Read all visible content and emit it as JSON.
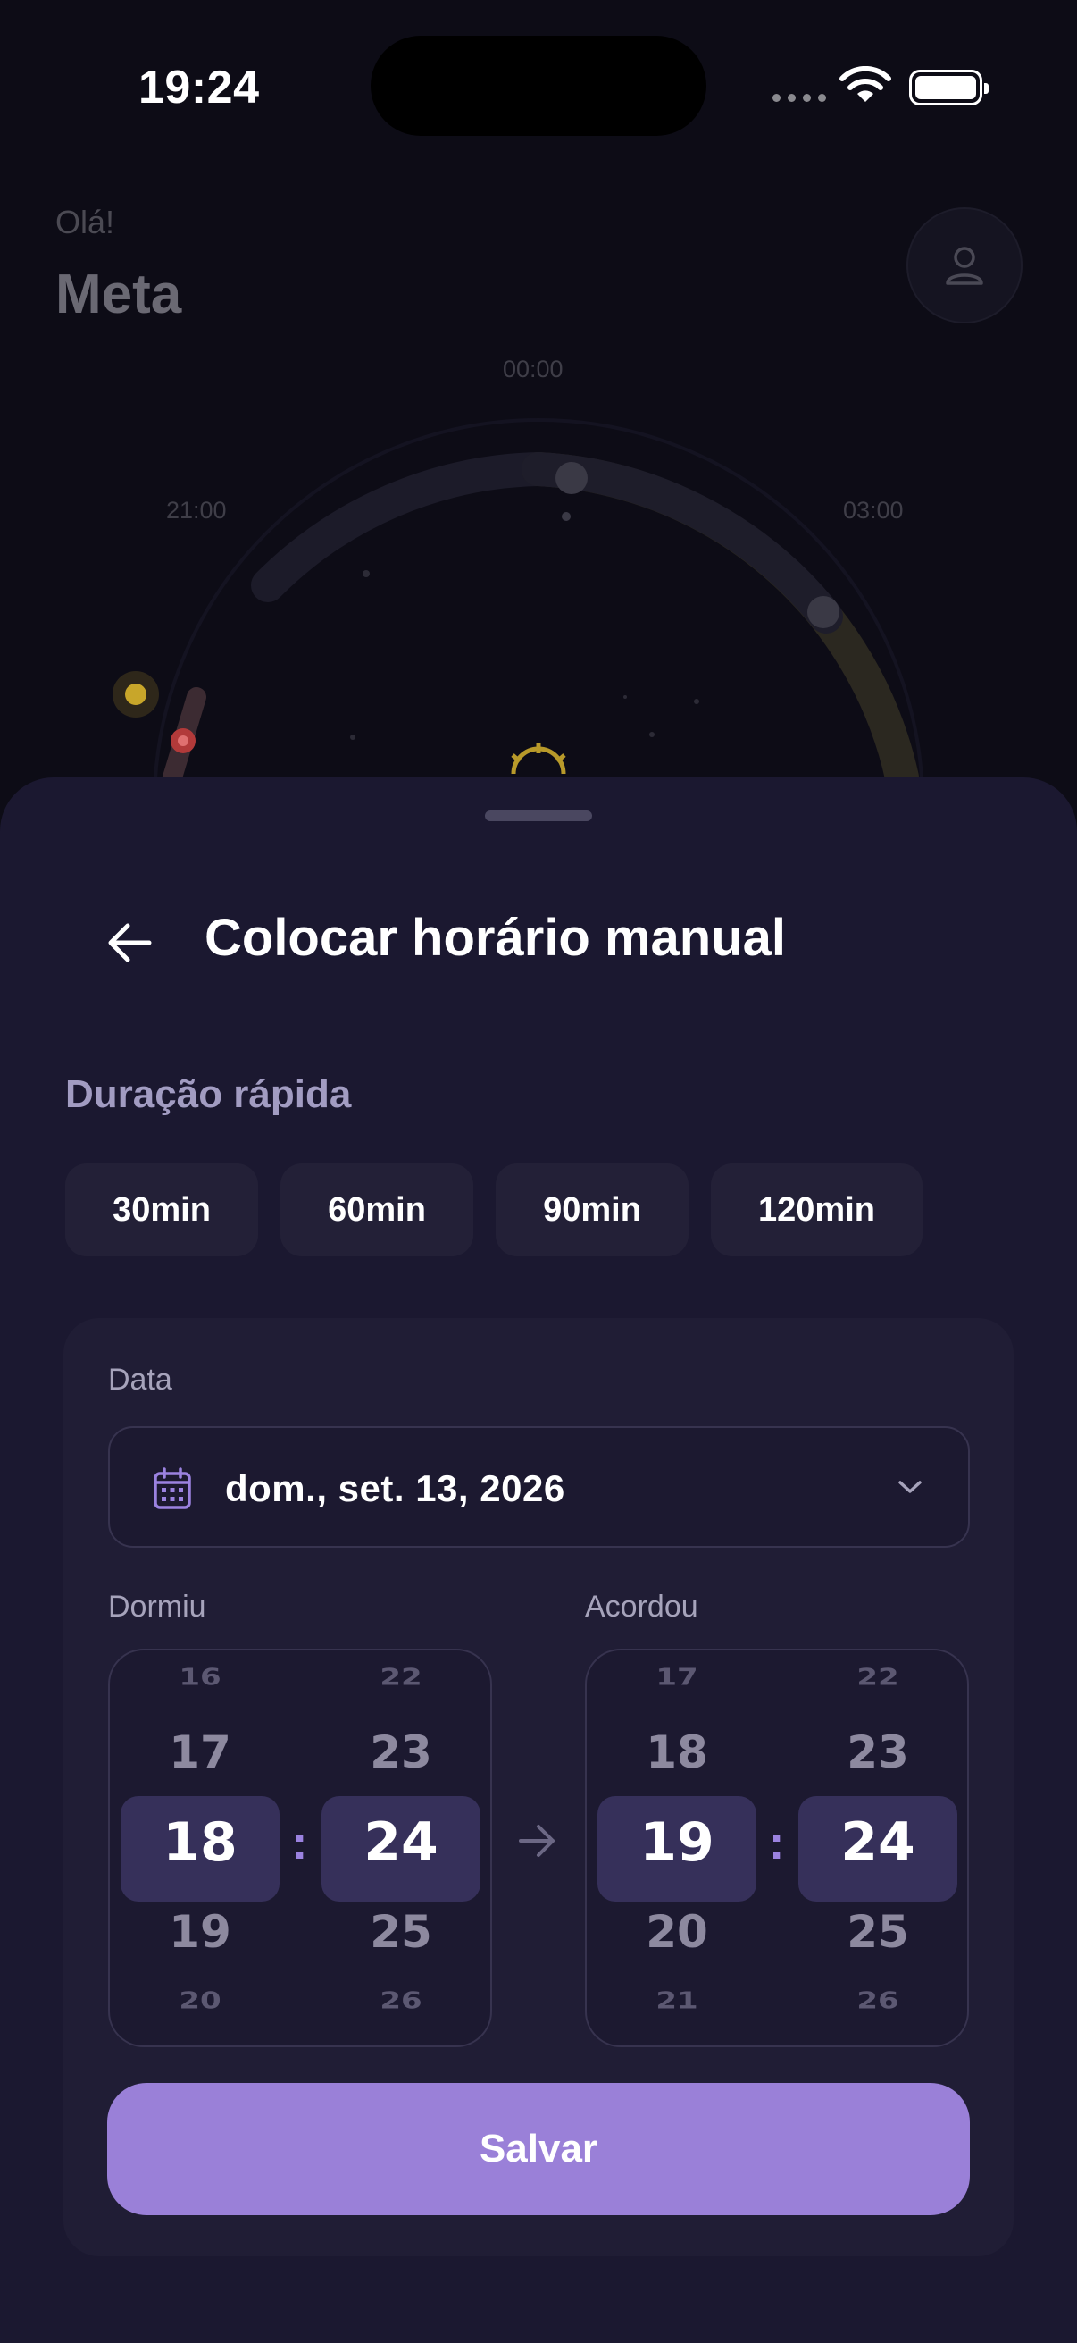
{
  "status_bar": {
    "time": "19:24"
  },
  "home": {
    "greeting": "Olá!",
    "title": "Meta",
    "clock_labels": {
      "top": "00:00",
      "left": "21:00",
      "right": "03:00"
    }
  },
  "sheet": {
    "title": "Colocar horário manual",
    "quick_duration": {
      "label": "Duração rápida",
      "options": [
        "30min",
        "60min",
        "90min",
        "120min"
      ]
    },
    "date": {
      "label": "Data",
      "value": "dom., set. 13, 2026"
    },
    "slept": {
      "label": "Dormiu",
      "hours": [
        "16",
        "17",
        "18",
        "19",
        "20"
      ],
      "minutes": [
        "22",
        "23",
        "24",
        "25",
        "26"
      ]
    },
    "woke": {
      "label": "Acordou",
      "hours": [
        "17",
        "18",
        "19",
        "20",
        "21"
      ],
      "minutes": [
        "22",
        "23",
        "24",
        "25",
        "26"
      ]
    },
    "separator": ":",
    "save_label": "Salvar"
  },
  "colors": {
    "accent": "#9a80d8",
    "sheet_bg": "#1b1830",
    "card_bg": "#201d35"
  }
}
